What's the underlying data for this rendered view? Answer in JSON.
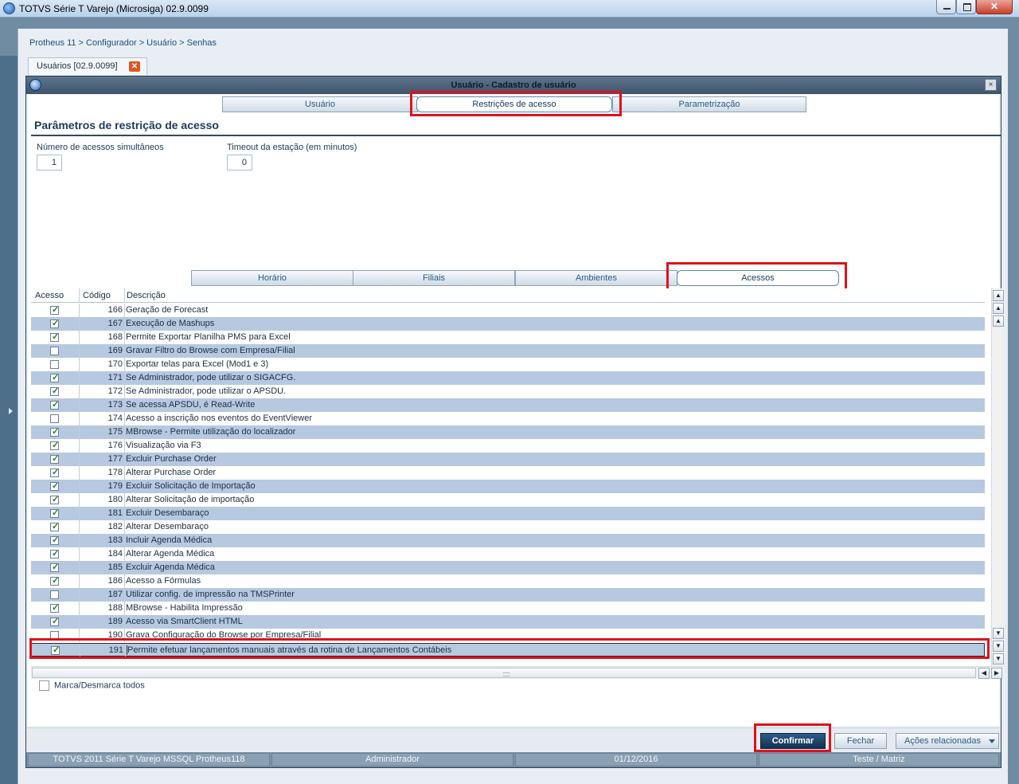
{
  "app": {
    "title": "TOTVS Série T Varejo (Microsiga) 02.9.0099",
    "close_glyph": "✕"
  },
  "breadcrumb": "Protheus 11 > Configurador > Usuário > Senhas",
  "doc_tab": {
    "label": "Usuários [02.9.0099]",
    "close_glyph": "✕"
  },
  "window": {
    "title": "Usuário - Cadastro de usuário",
    "close_glyph": "×",
    "top_tabs": [
      "Usuário",
      "Restrições de acesso",
      "Parametrização"
    ],
    "section_title": "Parâmetros de restrição de acesso",
    "fields": {
      "simultaneous_label": "Número de acessos simultâneos",
      "simultaneous_value": "1",
      "timeout_label": "Timeout da estação (em minutos)",
      "timeout_value": "0"
    },
    "sub_tabs": [
      "Horário",
      "Filiais",
      "Ambientes",
      "Acessos"
    ]
  },
  "grid": {
    "headers": {
      "acesso": "Acesso",
      "codigo": "Código",
      "descricao": "Descrição"
    },
    "rows": [
      {
        "checked": true,
        "code": "166",
        "desc": "Geração de Forecast"
      },
      {
        "checked": true,
        "code": "167",
        "desc": "Execução de Mashups"
      },
      {
        "checked": true,
        "code": "168",
        "desc": "Permite Exportar Planilha PMS para Excel"
      },
      {
        "checked": false,
        "code": "169",
        "desc": "Gravar Filtro do Browse com Empresa/Filial"
      },
      {
        "checked": false,
        "code": "170",
        "desc": "Exportar telas para Excel (Mod1 e 3)"
      },
      {
        "checked": true,
        "code": "171",
        "desc": "Se Administrador, pode utilizar o SIGACFG."
      },
      {
        "checked": true,
        "code": "172",
        "desc": "Se Administrador, pode utilizar o APSDU."
      },
      {
        "checked": true,
        "code": "173",
        "desc": "Se acessa APSDU, é Read-Write"
      },
      {
        "checked": false,
        "code": "174",
        "desc": "Acesso a inscrição nos eventos do EventViewer"
      },
      {
        "checked": true,
        "code": "175",
        "desc": "MBrowse - Permite utilização do localizador"
      },
      {
        "checked": true,
        "code": "176",
        "desc": "Visualização via F3"
      },
      {
        "checked": true,
        "code": "177",
        "desc": "Excluir Purchase Order"
      },
      {
        "checked": true,
        "code": "178",
        "desc": "Alterar Purchase Order"
      },
      {
        "checked": true,
        "code": "179",
        "desc": "Excluir Solicitação de Importação"
      },
      {
        "checked": true,
        "code": "180",
        "desc": "Alterar Solicitação de importação"
      },
      {
        "checked": true,
        "code": "181",
        "desc": "Excluir Desembaraço"
      },
      {
        "checked": true,
        "code": "182",
        "desc": "Alterar Desembaraço"
      },
      {
        "checked": true,
        "code": "183",
        "desc": "Incluir Agenda Médica"
      },
      {
        "checked": true,
        "code": "184",
        "desc": "Alterar Agenda Médica"
      },
      {
        "checked": true,
        "code": "185",
        "desc": "Excluir Agenda Médica"
      },
      {
        "checked": true,
        "code": "186",
        "desc": "Acesso a Fórmulas"
      },
      {
        "checked": false,
        "code": "187",
        "desc": "Utilizar config. de impressão na TMSPrinter"
      },
      {
        "checked": true,
        "code": "188",
        "desc": "MBrowse - Habilita Impressão"
      },
      {
        "checked": true,
        "code": "189",
        "desc": "Acesso via SmartClient HTML"
      },
      {
        "checked": false,
        "code": "190",
        "desc": "Grava Configuração do Browse por Empresa/Filial"
      },
      {
        "checked": true,
        "code": "191",
        "desc": "Permite efetuar lançamentos manuais através da rotina de Lançamentos Contábeis"
      }
    ]
  },
  "marca_label": "Marca/Desmarca todos",
  "buttons": {
    "confirm": "Confirmar",
    "close": "Fechar",
    "actions": "Ações relacionadas"
  },
  "status": [
    "TOTVS 2011 Série T Varejo MSSQL Protheus118",
    "Administrador",
    "01/12/2016",
    "Teste / Matriz"
  ],
  "colors": {
    "accent": "#12314f",
    "highlight": "#e0111b",
    "row_alt": "#b6c9e0"
  }
}
